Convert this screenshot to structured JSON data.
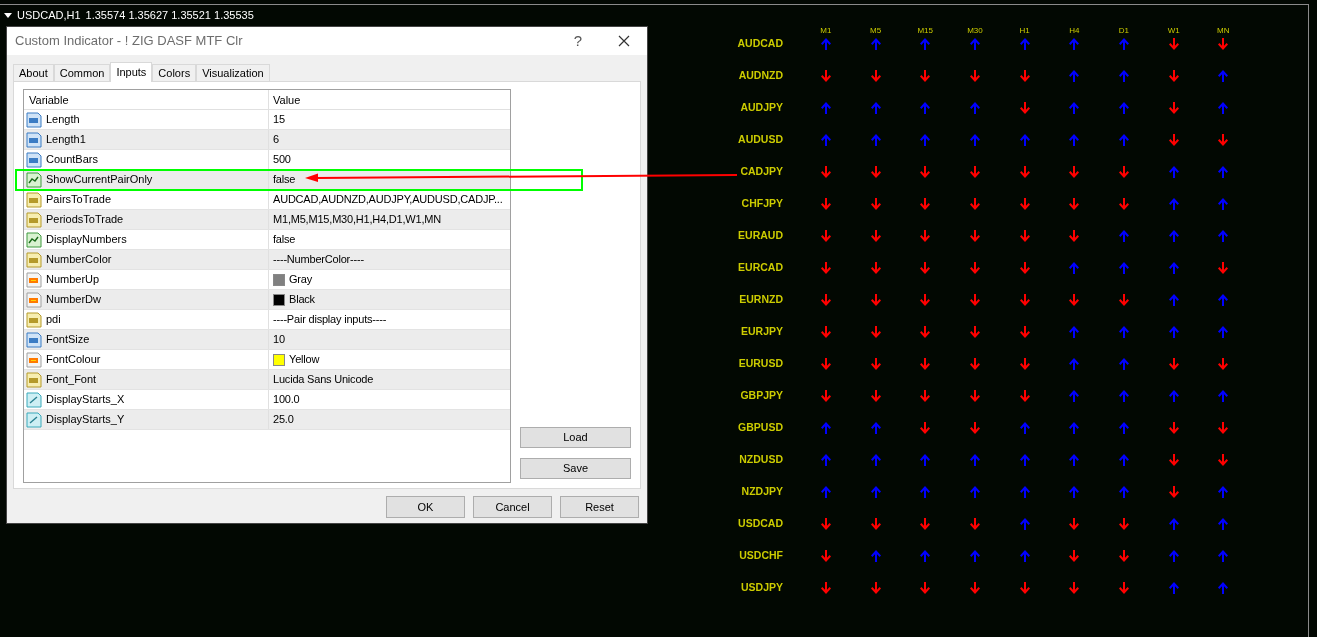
{
  "chart": {
    "symbol": "USDCAD,H1",
    "prices": "1.35574 1.35627 1.35521 1.35535"
  },
  "dialog": {
    "title": "Custom Indicator - ! ZIG DASF MTF Clr",
    "help": "?",
    "tabs": [
      {
        "label": "About",
        "selected": false
      },
      {
        "label": "Common",
        "selected": false
      },
      {
        "label": "Inputs",
        "selected": true
      },
      {
        "label": "Colors",
        "selected": false
      },
      {
        "label": "Visualization",
        "selected": false
      }
    ],
    "table": {
      "columns": [
        "Variable",
        "Value"
      ],
      "rows": [
        {
          "kind": "int",
          "name": "Length",
          "value": "15",
          "highlighted": false
        },
        {
          "kind": "int",
          "name": "Length1",
          "value": "6",
          "highlighted": false
        },
        {
          "kind": "int",
          "name": "CountBars",
          "value": "500",
          "highlighted": false
        },
        {
          "kind": "bool",
          "name": "ShowCurrentPairOnly",
          "value": "false",
          "highlighted": true
        },
        {
          "kind": "string",
          "name": "PairsToTrade",
          "value": "AUDCAD,AUDNZD,AUDJPY,AUDUSD,CADJP...",
          "highlighted": false
        },
        {
          "kind": "string",
          "name": "PeriodsToTrade",
          "value": "M1,M5,M15,M30,H1,H4,D1,W1,MN",
          "highlighted": false
        },
        {
          "kind": "bool",
          "name": "DisplayNumbers",
          "value": "false",
          "highlighted": false
        },
        {
          "kind": "string",
          "name": "NumberColor",
          "value": "----NumberColor----",
          "highlighted": false
        },
        {
          "kind": "color",
          "name": "NumberUp",
          "value": "Gray",
          "color": "#808080",
          "highlighted": false
        },
        {
          "kind": "color",
          "name": "NumberDw",
          "value": "Black",
          "color": "#000000",
          "highlighted": false
        },
        {
          "kind": "string",
          "name": "pdi",
          "value": "----Pair display inputs----",
          "highlighted": false
        },
        {
          "kind": "int",
          "name": "FontSize",
          "value": "10",
          "highlighted": false
        },
        {
          "kind": "color",
          "name": "FontColour",
          "value": "Yellow",
          "color": "#ffff00",
          "highlighted": false
        },
        {
          "kind": "string",
          "name": "Font_Font",
          "value": "Lucida Sans Unicode",
          "highlighted": false
        },
        {
          "kind": "double",
          "name": "DisplayStarts_X",
          "value": "100.0",
          "highlighted": false
        },
        {
          "kind": "double",
          "name": "DisplayStarts_Y",
          "value": "25.0",
          "highlighted": false
        }
      ]
    },
    "side_buttons": [
      "Load",
      "Save"
    ],
    "buttons": [
      "OK",
      "Cancel",
      "Reset"
    ]
  },
  "grid": {
    "periods": [
      "M1",
      "M5",
      "M15",
      "M30",
      "H1",
      "H4",
      "D1",
      "W1",
      "MN"
    ],
    "rows": [
      {
        "pair": "AUDCAD",
        "up": [
          true,
          true,
          true,
          true,
          true,
          true,
          true,
          false,
          false
        ]
      },
      {
        "pair": "AUDNZD",
        "up": [
          false,
          false,
          false,
          false,
          false,
          true,
          true,
          false,
          true
        ]
      },
      {
        "pair": "AUDJPY",
        "up": [
          true,
          true,
          true,
          true,
          false,
          true,
          true,
          false,
          true
        ]
      },
      {
        "pair": "AUDUSD",
        "up": [
          true,
          true,
          true,
          true,
          true,
          true,
          true,
          false,
          false
        ]
      },
      {
        "pair": "CADJPY",
        "up": [
          false,
          false,
          false,
          false,
          false,
          false,
          false,
          true,
          true
        ]
      },
      {
        "pair": "CHFJPY",
        "up": [
          false,
          false,
          false,
          false,
          false,
          false,
          false,
          true,
          true
        ]
      },
      {
        "pair": "EURAUD",
        "up": [
          false,
          false,
          false,
          false,
          false,
          false,
          true,
          true,
          true
        ]
      },
      {
        "pair": "EURCAD",
        "up": [
          false,
          false,
          false,
          false,
          false,
          true,
          true,
          true,
          false
        ]
      },
      {
        "pair": "EURNZD",
        "up": [
          false,
          false,
          false,
          false,
          false,
          false,
          false,
          true,
          true
        ]
      },
      {
        "pair": "EURJPY",
        "up": [
          false,
          false,
          false,
          false,
          false,
          true,
          true,
          true,
          true
        ]
      },
      {
        "pair": "EURUSD",
        "up": [
          false,
          false,
          false,
          false,
          false,
          true,
          true,
          false,
          false
        ]
      },
      {
        "pair": "GBPJPY",
        "up": [
          false,
          false,
          false,
          false,
          false,
          true,
          true,
          true,
          true
        ]
      },
      {
        "pair": "GBPUSD",
        "up": [
          true,
          true,
          false,
          false,
          true,
          true,
          true,
          false,
          false
        ]
      },
      {
        "pair": "NZDUSD",
        "up": [
          true,
          true,
          true,
          true,
          true,
          true,
          true,
          false,
          false
        ]
      },
      {
        "pair": "NZDJPY",
        "up": [
          true,
          true,
          true,
          true,
          true,
          true,
          true,
          false,
          true
        ]
      },
      {
        "pair": "USDCAD",
        "up": [
          false,
          false,
          false,
          false,
          true,
          false,
          false,
          true,
          true
        ]
      },
      {
        "pair": "USDCHF",
        "up": [
          false,
          true,
          true,
          true,
          true,
          false,
          false,
          true,
          true
        ]
      },
      {
        "pair": "USDJPY",
        "up": [
          false,
          false,
          false,
          false,
          false,
          false,
          false,
          true,
          true
        ]
      }
    ]
  }
}
